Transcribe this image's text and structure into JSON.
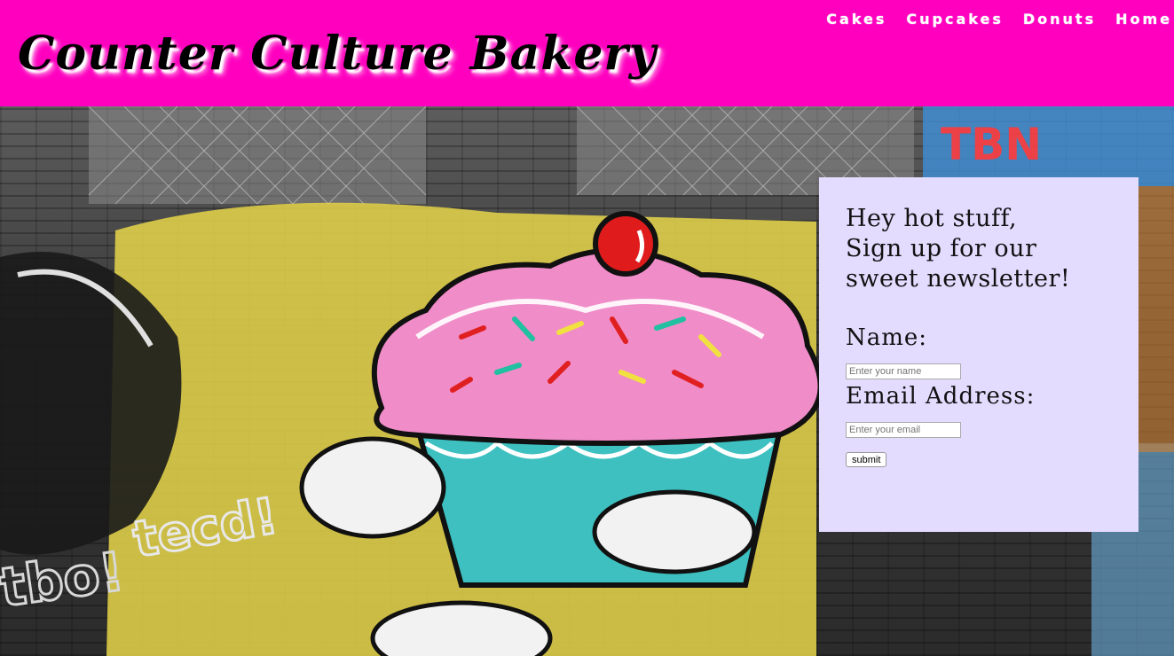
{
  "header": {
    "site_title": "Counter Culture Bakery",
    "nav": [
      "Cakes",
      "Cupcakes",
      "Donuts",
      "Home"
    ]
  },
  "newsletter": {
    "heading_lines": [
      "Hey hot stuff,",
      "Sign up for our",
      "sweet newsletter!"
    ],
    "name_label": "Name:",
    "name_placeholder": "Enter your name",
    "email_label": "Email Address:",
    "email_placeholder": "Enter your email",
    "submit_label": "submit"
  },
  "colors": {
    "header_bg": "#ff00bf",
    "panel_bg": "#e3dcff"
  }
}
